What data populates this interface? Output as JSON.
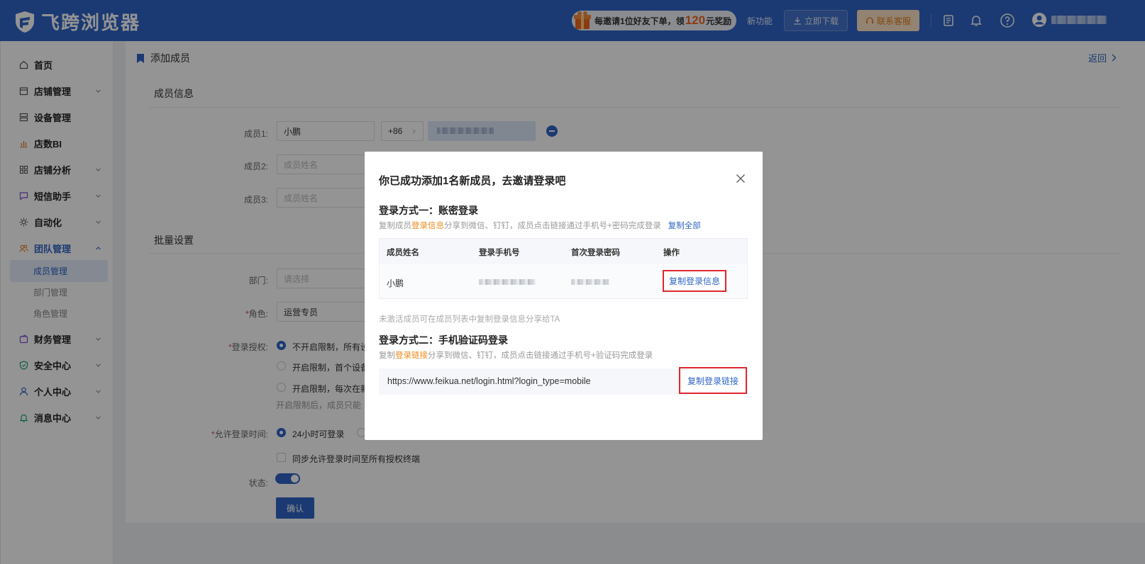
{
  "app": {
    "name": "飞跨浏览器"
  },
  "header": {
    "promo": {
      "prefix": "每邀请1位好友下单，领",
      "amount": "120",
      "suffix": "元奖励"
    },
    "new_feature": "新功能",
    "download": "立即下载",
    "contact": "联系客服"
  },
  "sidebar": {
    "items": [
      {
        "label": "首页",
        "icon": "home-icon"
      },
      {
        "label": "店铺管理",
        "icon": "store-icon"
      },
      {
        "label": "设备管理",
        "icon": "server-icon"
      },
      {
        "label": "店数BI",
        "icon": "bar-chart-icon"
      },
      {
        "label": "店铺分析",
        "icon": "grid-icon"
      },
      {
        "label": "短信助手",
        "icon": "message-icon"
      },
      {
        "label": "自动化",
        "icon": "gear-icon"
      },
      {
        "label": "团队管理",
        "icon": "team-icon"
      },
      {
        "label": "财务管理",
        "icon": "wallet-icon"
      },
      {
        "label": "安全中心",
        "icon": "shield-icon"
      },
      {
        "label": "个人中心",
        "icon": "user-icon"
      },
      {
        "label": "消息中心",
        "icon": "bell-icon"
      }
    ],
    "team_sub": [
      "成员管理",
      "部门管理",
      "角色管理"
    ]
  },
  "page": {
    "title": "添加成员",
    "back": "返回",
    "member_section": "成员信息",
    "member1_label": "成员1:",
    "member1_name": "小鹏",
    "country_code": "+86",
    "member2_label": "成员2:",
    "member3_label": "成员3:",
    "name_placeholder": "成员姓名",
    "batch_section": "批量设置",
    "dept_label": "部门:",
    "dept_placeholder": "请选择",
    "role_label": "角色:",
    "role_value": "运营专员",
    "auth_label": "登录授权:",
    "auth_options": [
      "不开启限制，所有设",
      "开启限制，首个设备",
      "开启限制，每次在新"
    ],
    "auth_hint": "开启限制后，成员只能",
    "time_label": "允许登录时间:",
    "time_option": "24小时可登录",
    "sync_label": "同步允许登录时间至所有授权终端",
    "status_label": "状态:",
    "confirm": "确认"
  },
  "modal": {
    "title": "你已成功添加1名新成员，去邀请登录吧",
    "method1_title": "登录方式一：账密登录",
    "method1_desc": {
      "pre": "复制成员",
      "hl": "登录信息",
      "post": "分享到微信、钉钉，成员点击链接通过手机号+密码完成登录"
    },
    "copy_all": "复制全部",
    "table": {
      "headers": [
        "成员姓名",
        "登录手机号",
        "首次登录密码",
        "操作"
      ],
      "row": {
        "name": "小鹏",
        "action": "复制登录信息"
      }
    },
    "note": "未激活成员可在成员列表中复制登录信息分享给TA",
    "method2_title": "登录方式二：手机验证码登录",
    "method2_desc": {
      "pre": "复制",
      "hl": "登录链接",
      "post": "分享到微信、钉钉，成员点击链接通过手机号+验证码完成登录"
    },
    "link": "https://www.feikua.net/login.html?login_type=mobile",
    "copy_link": "复制登录链接"
  },
  "colors": {
    "primary": "#2f64c6",
    "highlight": "#f08a1f",
    "annotation": "#e0272e"
  }
}
